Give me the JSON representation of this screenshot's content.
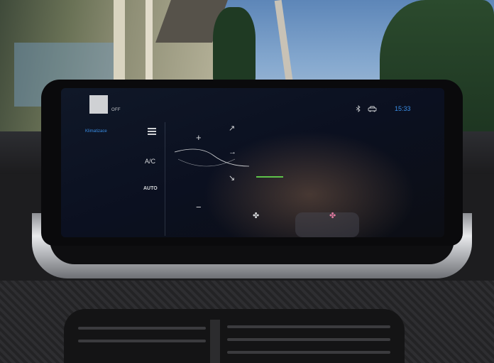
{
  "screen": {
    "status_left": "OFF",
    "clock": "15:33",
    "side_tab_label": "Klimatizace",
    "ac_label": "A/C",
    "auto_label": "AUTO",
    "plus_glyph": "+",
    "minus_glyph": "−"
  },
  "icons": {
    "bluetooth": "bluetooth-icon",
    "car": "car-icon",
    "menu": "hamburger-menu-icon",
    "fan_front": "fan-icon",
    "fan_rear": "rear-fan-icon"
  },
  "colors": {
    "accent_blue": "#3a8ee6",
    "ui_text": "#d8dadd",
    "indicator_green": "#5ec34a"
  }
}
